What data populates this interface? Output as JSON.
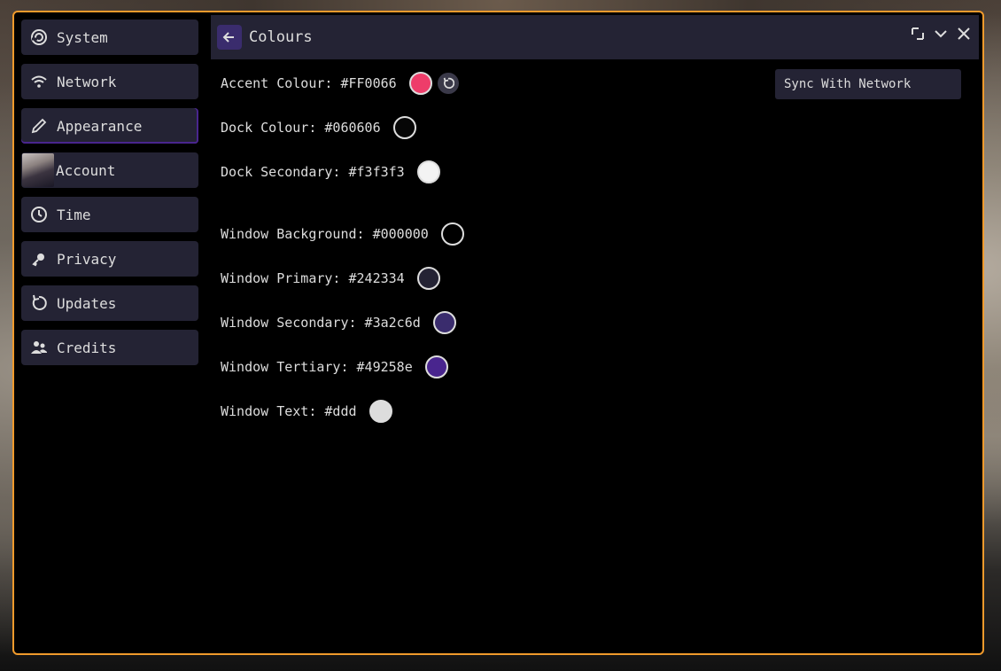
{
  "window": {
    "border_color": "#f09a2c",
    "background": "#000000"
  },
  "sidebar": {
    "items": [
      {
        "label": "System",
        "icon": "system-icon"
      },
      {
        "label": "Network",
        "icon": "wifi-icon"
      },
      {
        "label": "Appearance",
        "icon": "pencil-icon",
        "active": true
      },
      {
        "label": "Account",
        "icon": "avatar"
      },
      {
        "label": "Time",
        "icon": "clock-icon"
      },
      {
        "label": "Privacy",
        "icon": "key-icon"
      },
      {
        "label": "Updates",
        "icon": "refresh-icon"
      },
      {
        "label": "Credits",
        "icon": "people-icon"
      }
    ]
  },
  "titlebar": {
    "title": "Colours",
    "back_icon": "arrow-left-icon",
    "controls": [
      "resize-icon",
      "chevron-down-icon",
      "close-icon"
    ]
  },
  "settings": {
    "accent": {
      "label": "Accent Colour: #FF0066",
      "color": "#ee3d6a"
    },
    "dock": {
      "label": "Dock Colour: #060606",
      "color": "#060606"
    },
    "dock_secondary": {
      "label": "Dock Secondary: #f3f3f3",
      "color": "#f3f3f3"
    },
    "window_background": {
      "label": "Window Background: #000000",
      "color": "#000000"
    },
    "window_primary": {
      "label": "Window Primary: #242334",
      "color": "#242334"
    },
    "window_secondary": {
      "label": "Window Secondary: #3a2c6d",
      "color": "#3a2c6d"
    },
    "window_tertiary": {
      "label": "Window Tertiary: #49258e",
      "color": "#49258e"
    },
    "window_text": {
      "label": "Window Text: #ddd",
      "color": "#dddddd"
    }
  },
  "sync_button": {
    "label": "Sync With Network"
  },
  "accent_ui": "#3a2c6d"
}
